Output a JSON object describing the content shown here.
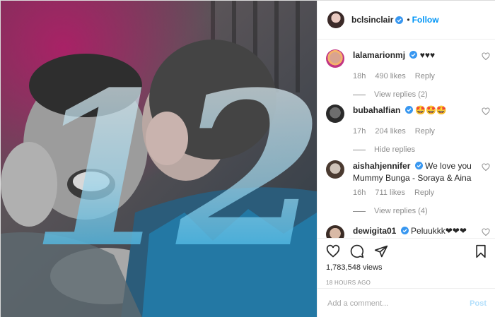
{
  "post": {
    "author": "bclsinclair",
    "follow_label": "Follow",
    "views": "1,783,548 views",
    "time": "18 HOURS AGO",
    "comment_placeholder": "Add a comment...",
    "post_label": "Post"
  },
  "media": {
    "overlay_number": "12",
    "colors": {
      "digit_blue": "#2fb4e6",
      "tint_pink": "#c0156b"
    }
  },
  "comments": [
    {
      "username": "lalamarionmj",
      "text": "♥♥♥",
      "age": "18h",
      "likes": "490 likes",
      "reply": "Reply",
      "view_replies": "View replies (2)"
    },
    {
      "username": "bubahalfian",
      "text": "🤩🤩🤩",
      "age": "17h",
      "likes": "204 likes",
      "reply": "Reply",
      "view_replies": "Hide replies"
    },
    {
      "username": "aishahjennifer",
      "text": "We love you Mummy Bunga - Soraya & Aina",
      "age": "16h",
      "likes": "711 likes",
      "reply": "Reply",
      "view_replies": "View replies (4)"
    },
    {
      "username": "dewigita01",
      "text": "Peluukkk❤❤❤"
    }
  ],
  "icons": {
    "like": "heart-icon",
    "comment": "comment-icon",
    "share": "share-icon",
    "save": "bookmark-icon",
    "verified": "verified-badge-icon"
  },
  "theme": {
    "accent": "#0095f6",
    "muted": "#8e8e8e",
    "text": "#262626"
  }
}
